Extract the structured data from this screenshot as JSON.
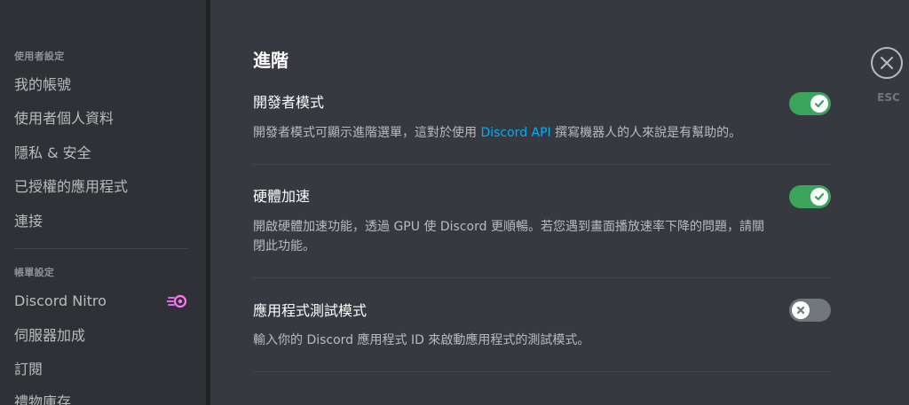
{
  "sidebar": {
    "user_settings_header": "使用者設定",
    "user_items": [
      {
        "label": "我的帳號"
      },
      {
        "label": "使用者個人資料"
      },
      {
        "label": "隱私 & 安全"
      },
      {
        "label": "已授權的應用程式"
      },
      {
        "label": "連接"
      }
    ],
    "billing_header": "帳單設定",
    "billing_items": [
      {
        "label": "Discord Nitro",
        "icon": "nitro-icon"
      },
      {
        "label": "伺服器加成"
      },
      {
        "label": "訂閱"
      },
      {
        "label": "禮物庫存"
      }
    ]
  },
  "main": {
    "section_title": "進階",
    "settings": [
      {
        "title": "開發者模式",
        "desc_before": "開發者模式可顯示進階選單，這對於使用 ",
        "desc_link": "Discord API",
        "desc_after": " 撰寫機器人的人來說是有幫助的。",
        "enabled": true
      },
      {
        "title": "硬體加速",
        "desc_line1": "開啟硬體加速功能，透過 GPU 使 Discord 更順暢。若您遇到畫面播放速率下降的問題，請關",
        "desc_line2": "閉此功能。",
        "enabled": true
      },
      {
        "title": "應用程式測試模式",
        "desc": "輸入你的 Discord 應用程式 ID 來啟動應用程式的測試模式。",
        "enabled": false
      }
    ]
  },
  "close": {
    "label": "ESC",
    "icon": "close-icon"
  },
  "colors": {
    "toggle_on": "#3ba55c",
    "toggle_off": "#72767d",
    "link": "#00aff4",
    "nitro": "#ff73fa"
  }
}
